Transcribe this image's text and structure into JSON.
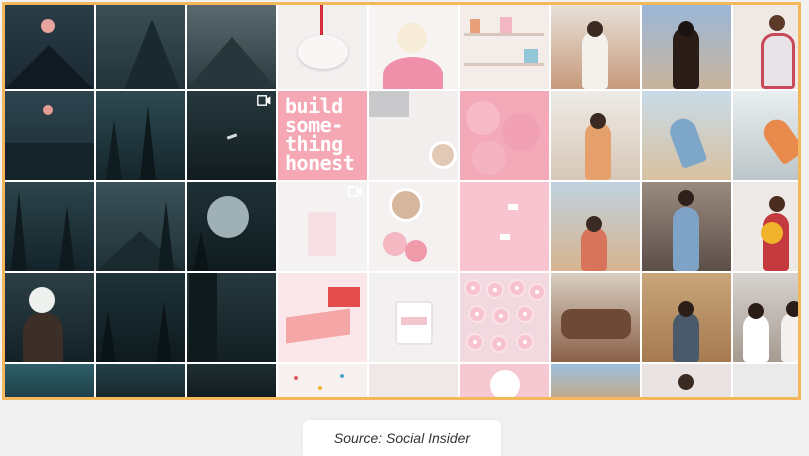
{
  "feed_grid": {
    "quote_tile_text": "build\nsome-\nthing\nhonest",
    "video_icon": "video-camera-icon"
  },
  "caption": {
    "text": "Source: Social Insider"
  },
  "colors": {
    "frame_border": "#f5b75b",
    "dark_theme": "#1f3a44",
    "pink_theme": "#f4b6c2",
    "warm_theme": "#c9a27f"
  }
}
